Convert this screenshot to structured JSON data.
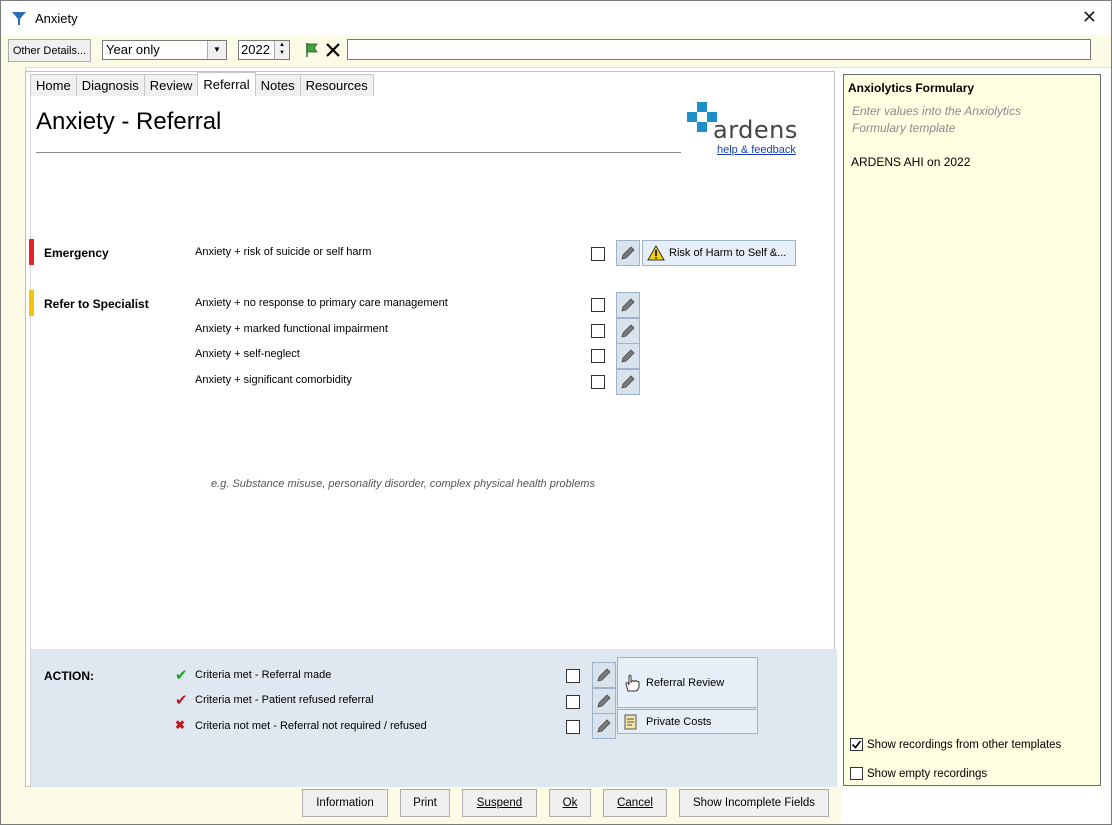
{
  "window": {
    "title": "Anxiety"
  },
  "toolbar": {
    "other_details_label": "Other Details...",
    "period_value": "Year only",
    "year_value": "2022",
    "search_value": ""
  },
  "tabs": [
    "Home",
    "Diagnosis",
    "Review",
    "Referral",
    "Notes",
    "Resources"
  ],
  "page": {
    "heading": "Anxiety - Referral",
    "logo_text": "ardens",
    "help_link": "help & feedback"
  },
  "emergency": {
    "label": "Emergency",
    "color": "#e8202a",
    "item": "Anxiety + risk of suicide or self harm",
    "risk_button": "Risk of Harm to Self &..."
  },
  "specialist": {
    "label": "Refer to Specialist",
    "color": "#f2c500",
    "items": [
      "Anxiety + no response to primary care management",
      "Anxiety + marked functional impairment",
      "Anxiety + self-neglect",
      "Anxiety + significant comorbidity"
    ],
    "hint": "e.g. Substance misuse, personality disorder, complex physical health problems"
  },
  "action": {
    "label": "ACTION:",
    "items": [
      "Criteria met - Referral made",
      "Criteria met - Patient refused referral",
      "Criteria not met - Referral not required / refused"
    ],
    "referral_review": "Referral Review",
    "private_costs": "Private Costs"
  },
  "side": {
    "title": "Anxiolytics Formulary",
    "hint": "Enter values into the Anxiolytics Formulary template",
    "entry": "ARDENS AHI on 2022",
    "show_other_label": "Show recordings from other templates",
    "show_other_checked": true,
    "show_empty_label": "Show empty recordings",
    "show_empty_checked": false
  },
  "buttons": {
    "information": "Information",
    "print": "Print",
    "suspend": "Suspend",
    "ok": "Ok",
    "cancel": "Cancel",
    "show_incomplete": "Show Incomplete Fields"
  }
}
